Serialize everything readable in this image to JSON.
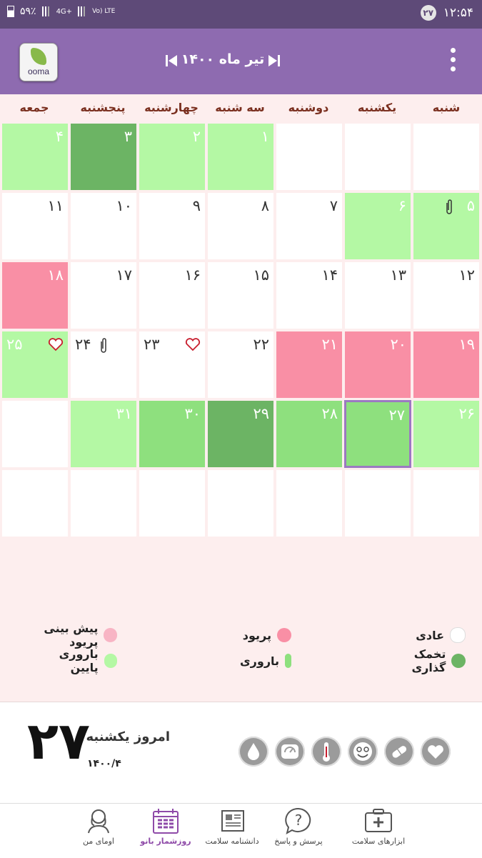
{
  "status": {
    "time": "۱۲:۵۴",
    "badge": "۲۷",
    "battery": "۵۹٪",
    "net": "4G+",
    "volte": "Vo) LTE"
  },
  "header": {
    "logo": "ooma",
    "month_title": "تیر ماه ۱۴۰۰"
  },
  "weekdays": [
    "جمعه",
    "پنجشنبه",
    "چهارشنبه",
    "سه شنبه",
    "دوشنبه",
    "یکشنبه",
    "شنبه"
  ],
  "calendar": {
    "rows": [
      [
        "۴",
        "۳",
        "۲",
        "۱",
        "",
        "",
        ""
      ],
      [
        "۱۱",
        "۱۰",
        "۹",
        "۸",
        "۷",
        "۶",
        "۵"
      ],
      [
        "۱۸",
        "۱۷",
        "۱۶",
        "۱۵",
        "۱۴",
        "۱۳",
        "۱۲"
      ],
      [
        "۲۵",
        "۲۴",
        "۲۳",
        "۲۲",
        "۲۱",
        "۲۰",
        "۱۹"
      ],
      [
        "",
        "۳۱",
        "۳۰",
        "۲۹",
        "۲۸",
        "۲۷",
        "۲۶"
      ],
      [
        "",
        "",
        "",
        "",
        "",
        "",
        ""
      ]
    ],
    "today": "۲۷"
  },
  "legend": {
    "normal": "عادی",
    "period": "پریود",
    "predicted_period": "پیش بینی پریود",
    "ovulation": "تخمک گذاری",
    "fertility": "باروری",
    "low_fertility": "باروری پایین"
  },
  "today": {
    "day": "۲۷",
    "label": "امروز یکشنبه",
    "date": "۱۴۰۰/۴"
  },
  "nav": {
    "tools": "ابزارهای سلامت",
    "qa": "پرسش و پاسخ",
    "encyclopedia": "دانشنامه سلامت",
    "calendar": "روزشمار بانو",
    "profile": "اومای من"
  },
  "colors": {
    "appbar": "#8e6bb0",
    "statusbar": "#5e4a78",
    "fertility": "#b4f8a4",
    "ovulation": "#6cb464",
    "period": "#f98fa5",
    "predicted": "#f8b4c4"
  }
}
